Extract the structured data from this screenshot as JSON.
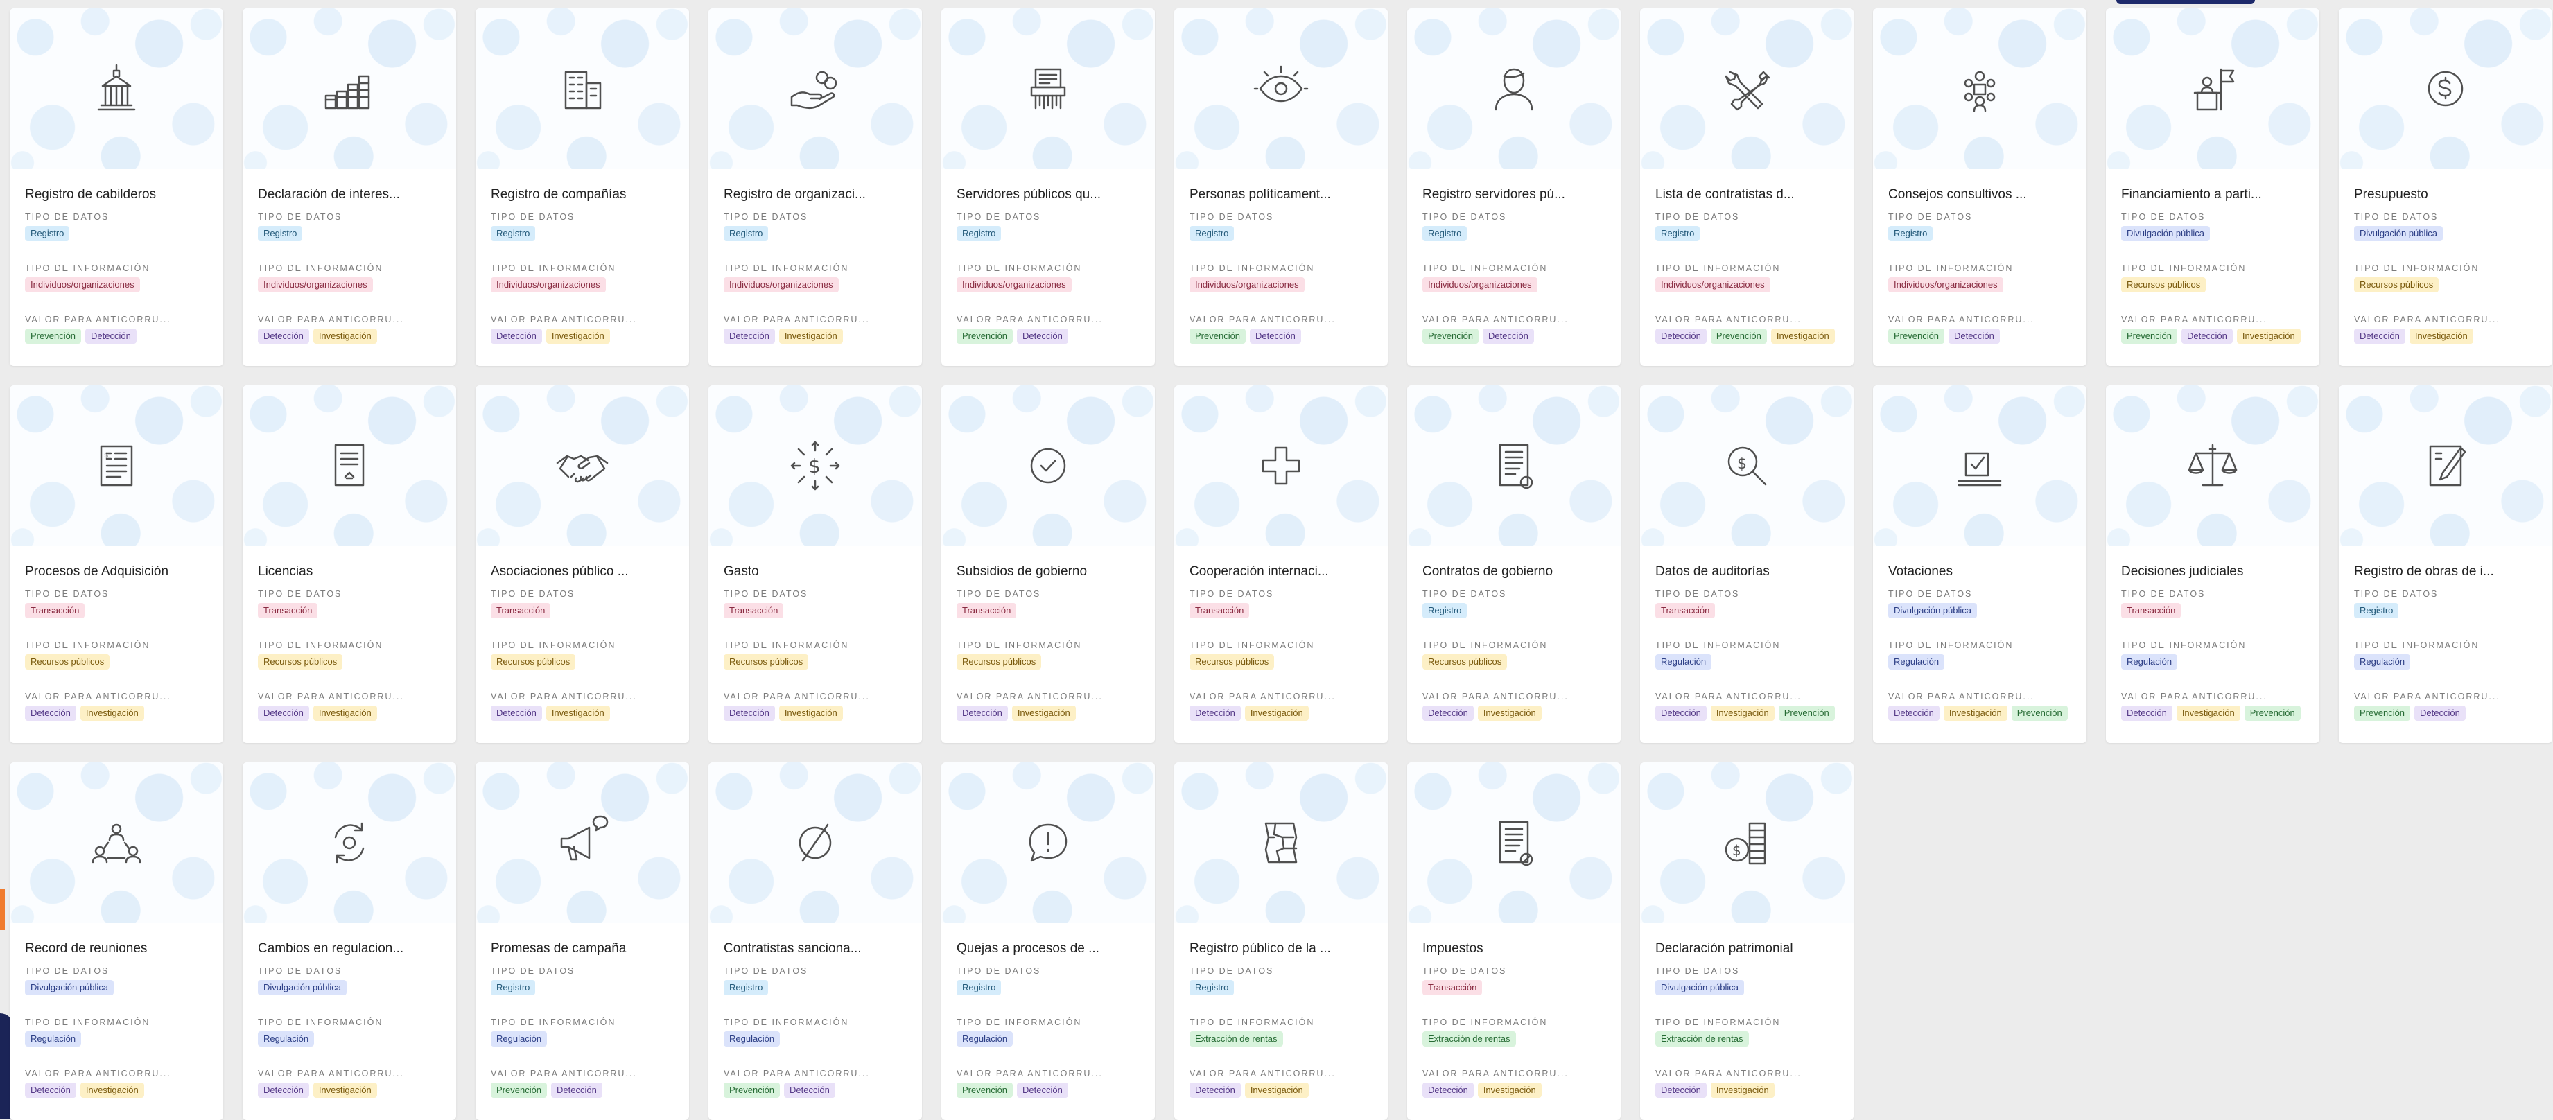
{
  "labels": {
    "tipo_datos": "TIPO DE DATOS",
    "tipo_info": "TIPO DE INFORMACIÓN",
    "valor": "VALOR PARA ANTICORRU..."
  },
  "cards": [
    {
      "title": "Registro de cabilderos",
      "icon": "government-building-icon",
      "tipo_datos": [
        "Registro"
      ],
      "tipo_info": [
        "Individuos/organizaciones"
      ],
      "valor": [
        "Prevención",
        "Detección"
      ]
    },
    {
      "title": "Declaración de interes...",
      "icon": "bar-chart-icon",
      "tipo_datos": [
        "Registro"
      ],
      "tipo_info": [
        "Individuos/organizaciones"
      ],
      "valor": [
        "Detección",
        "Investigación"
      ]
    },
    {
      "title": "Registro de compañías",
      "icon": "office-building-icon",
      "tipo_datos": [
        "Registro"
      ],
      "tipo_info": [
        "Individuos/organizaciones"
      ],
      "valor": [
        "Detección",
        "Investigación"
      ]
    },
    {
      "title": "Registro de organizaci...",
      "icon": "hand-coins-icon",
      "tipo_datos": [
        "Registro"
      ],
      "tipo_info": [
        "Individuos/organizaciones"
      ],
      "valor": [
        "Detección",
        "Investigación"
      ]
    },
    {
      "title": "Servidores públicos qu...",
      "icon": "paper-shredder-icon",
      "tipo_datos": [
        "Registro"
      ],
      "tipo_info": [
        "Individuos/organizaciones"
      ],
      "valor": [
        "Prevención",
        "Detección"
      ]
    },
    {
      "title": "Personas políticament...",
      "icon": "eye-icon",
      "tipo_datos": [
        "Registro"
      ],
      "tipo_info": [
        "Individuos/organizaciones"
      ],
      "valor": [
        "Prevención",
        "Detección"
      ]
    },
    {
      "title": "Registro servidores pú...",
      "icon": "person-icon",
      "tipo_datos": [
        "Registro"
      ],
      "tipo_info": [
        "Individuos/organizaciones"
      ],
      "valor": [
        "Prevención",
        "Detección"
      ]
    },
    {
      "title": "Lista de contratistas d...",
      "icon": "tools-icon",
      "tipo_datos": [
        "Registro"
      ],
      "tipo_info": [
        "Individuos/organizaciones"
      ],
      "valor": [
        "Detección",
        "Prevención",
        "Investigación"
      ]
    },
    {
      "title": "Consejos consultivos ...",
      "icon": "group-meeting-icon",
      "tipo_datos": [
        "Registro"
      ],
      "tipo_info": [
        "Individuos/organizaciones"
      ],
      "valor": [
        "Prevención",
        "Detección"
      ]
    },
    {
      "title": "Financiamiento a parti...",
      "icon": "podium-flag-icon",
      "tipo_datos": [
        "Divulgación pública"
      ],
      "tipo_info": [
        "Recursos públicos"
      ],
      "valor": [
        "Prevención",
        "Detección",
        "Investigación"
      ]
    },
    {
      "title": "Presupuesto",
      "icon": "dollar-circle-icon",
      "tipo_datos": [
        "Divulgación pública"
      ],
      "tipo_info": [
        "Recursos públicos"
      ],
      "valor": [
        "Detección",
        "Investigación"
      ]
    },
    {
      "title": "Procesos de Adquisición",
      "icon": "invoice-document-icon",
      "tipo_datos": [
        "Transacción"
      ],
      "tipo_info": [
        "Recursos públicos"
      ],
      "valor": [
        "Detección",
        "Investigación"
      ]
    },
    {
      "title": "Licencias",
      "icon": "license-document-icon",
      "tipo_datos": [
        "Transacción"
      ],
      "tipo_info": [
        "Recursos públicos"
      ],
      "valor": [
        "Detección",
        "Investigación"
      ]
    },
    {
      "title": "Asociaciones público ...",
      "icon": "handshake-icon",
      "tipo_datos": [
        "Transacción"
      ],
      "tipo_info": [
        "Recursos públicos"
      ],
      "valor": [
        "Detección",
        "Investigación"
      ]
    },
    {
      "title": "Gasto",
      "icon": "dollar-arrows-icon",
      "tipo_datos": [
        "Transacción"
      ],
      "tipo_info": [
        "Recursos públicos"
      ],
      "valor": [
        "Detección",
        "Investigación"
      ]
    },
    {
      "title": "Subsidios de gobierno",
      "icon": "check-circle-icon",
      "tipo_datos": [
        "Transacción"
      ],
      "tipo_info": [
        "Recursos públicos"
      ],
      "valor": [
        "Detección",
        "Investigación"
      ]
    },
    {
      "title": "Cooperación internaci...",
      "icon": "plus-cross-icon",
      "tipo_datos": [
        "Transacción"
      ],
      "tipo_info": [
        "Recursos públicos"
      ],
      "valor": [
        "Detección",
        "Investigación"
      ]
    },
    {
      "title": "Contratos de gobierno",
      "icon": "contract-document-icon",
      "tipo_datos": [
        "Registro"
      ],
      "tipo_info": [
        "Recursos públicos"
      ],
      "valor": [
        "Detección",
        "Investigación"
      ]
    },
    {
      "title": "Datos de auditorías",
      "icon": "dollar-magnifier-icon",
      "tipo_datos": [
        "Transacción"
      ],
      "tipo_info": [
        "Regulación"
      ],
      "valor": [
        "Detección",
        "Investigación",
        "Prevención"
      ]
    },
    {
      "title": "Votaciones",
      "icon": "ballot-box-icon",
      "tipo_datos": [
        "Divulgación pública"
      ],
      "tipo_info": [
        "Regulación"
      ],
      "valor": [
        "Detección",
        "Investigación",
        "Prevención"
      ]
    },
    {
      "title": "Decisiones judiciales",
      "icon": "scales-icon",
      "tipo_datos": [
        "Transacción"
      ],
      "tipo_info": [
        "Regulación"
      ],
      "valor": [
        "Detección",
        "Investigación",
        "Prevención"
      ]
    },
    {
      "title": "Registro de obras de i...",
      "icon": "notebook-pen-icon",
      "tipo_datos": [
        "Registro"
      ],
      "tipo_info": [
        "Regulación"
      ],
      "valor": [
        "Prevención",
        "Detección"
      ]
    },
    {
      "title": "Record de reuniones",
      "icon": "people-network-icon",
      "tipo_datos": [
        "Divulgación pública"
      ],
      "tipo_info": [
        "Regulación"
      ],
      "valor": [
        "Detección",
        "Investigación"
      ]
    },
    {
      "title": "Cambios en regulacion...",
      "icon": "refresh-cycle-icon",
      "tipo_datos": [
        "Divulgación pública"
      ],
      "tipo_info": [
        "Regulación"
      ],
      "valor": [
        "Detección",
        "Investigación"
      ]
    },
    {
      "title": "Promesas de campaña",
      "icon": "megaphone-icon",
      "tipo_datos": [
        "Registro"
      ],
      "tipo_info": [
        "Regulación"
      ],
      "valor": [
        "Prevención",
        "Detección"
      ]
    },
    {
      "title": "Contratistas sanciona...",
      "icon": "empty-set-icon",
      "tipo_datos": [
        "Registro"
      ],
      "tipo_info": [
        "Regulación"
      ],
      "valor": [
        "Prevención",
        "Detección"
      ]
    },
    {
      "title": "Quejas a procesos de ...",
      "icon": "alert-bubble-icon",
      "tipo_datos": [
        "Registro"
      ],
      "tipo_info": [
        "Regulación"
      ],
      "valor": [
        "Prevención",
        "Detección"
      ]
    },
    {
      "title": "Registro público de la ...",
      "icon": "land-map-icon",
      "tipo_datos": [
        "Registro"
      ],
      "tipo_info": [
        "Extracción de rentas"
      ],
      "valor": [
        "Detección",
        "Investigación"
      ]
    },
    {
      "title": "Impuestos",
      "icon": "tax-document-icon",
      "tipo_datos": [
        "Transacción"
      ],
      "tipo_info": [
        "Extracción de rentas"
      ],
      "valor": [
        "Detección",
        "Investigación"
      ]
    },
    {
      "title": "Declaración patrimonial",
      "icon": "money-stack-icon",
      "tipo_datos": [
        "Divulgación pública"
      ],
      "tipo_info": [
        "Extracción de rentas"
      ],
      "valor": [
        "Detección",
        "Investigación"
      ]
    }
  ],
  "chip_colors": {
    "Registro": "blue",
    "Transacción": "pink",
    "Divulgación pública": "indigo",
    "Individuos/organizaciones": "pink",
    "Recursos públicos": "yellow",
    "Regulación": "indigo",
    "Extracción de rentas": "green",
    "Prevención": "green",
    "Detección": "purple",
    "Investigación": "yellow"
  }
}
